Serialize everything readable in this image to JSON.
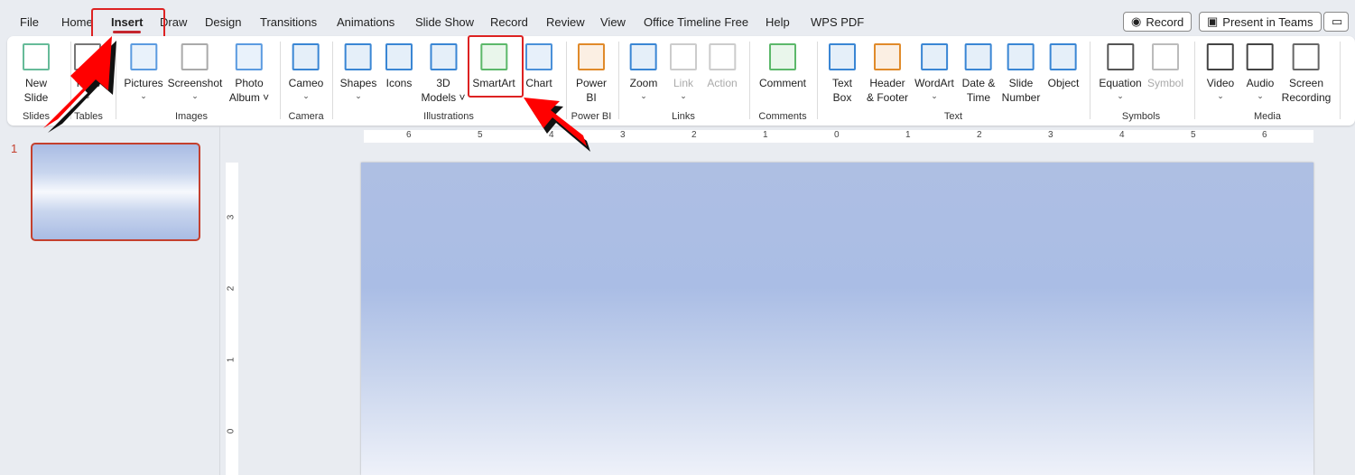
{
  "tabs": [
    "File",
    "Home",
    "Insert",
    "Draw",
    "Design",
    "Transitions",
    "Animations",
    "Slide Show",
    "Record",
    "Review",
    "View",
    "Office Timeline Free",
    "Help",
    "WPS PDF"
  ],
  "active_tab": "Insert",
  "top_buttons": {
    "record": "Record",
    "present": "Present in Teams"
  },
  "ribbon": {
    "buttons": [
      {
        "l1": "New",
        "l2": "Slide",
        "icon": "new-slide-icon",
        "chev": false,
        "dis": false
      },
      {
        "l1": "Table",
        "l2": "",
        "icon": "table-icon",
        "chev": true,
        "dis": false
      },
      {
        "l1": "Pictures",
        "l2": "",
        "icon": "pictures-icon",
        "chev": true,
        "dis": false
      },
      {
        "l1": "Screenshot",
        "l2": "",
        "icon": "screenshot-icon",
        "chev": true,
        "dis": false
      },
      {
        "l1": "Photo",
        "l2": "Album ˅",
        "icon": "photo-album-icon",
        "chev": false,
        "dis": false
      },
      {
        "l1": "Cameo",
        "l2": "",
        "icon": "cameo-icon",
        "chev": true,
        "dis": false
      },
      {
        "l1": "Shapes",
        "l2": "",
        "icon": "shapes-icon",
        "chev": true,
        "dis": false
      },
      {
        "l1": "Icons",
        "l2": "",
        "icon": "icons-icon",
        "chev": false,
        "dis": false
      },
      {
        "l1": "3D",
        "l2": "Models ˅",
        "icon": "3d-models-icon",
        "chev": false,
        "dis": false
      },
      {
        "l1": "SmartArt",
        "l2": "",
        "icon": "smartart-icon",
        "chev": false,
        "dis": false
      },
      {
        "l1": "Chart",
        "l2": "",
        "icon": "chart-icon",
        "chev": false,
        "dis": false
      },
      {
        "l1": "Power",
        "l2": "BI",
        "icon": "power-bi-icon",
        "chev": false,
        "dis": false
      },
      {
        "l1": "Zoom",
        "l2": "",
        "icon": "zoom-icon",
        "chev": true,
        "dis": false
      },
      {
        "l1": "Link",
        "l2": "",
        "icon": "link-icon",
        "chev": true,
        "dis": true
      },
      {
        "l1": "Action",
        "l2": "",
        "icon": "action-icon",
        "chev": false,
        "dis": true
      },
      {
        "l1": "Comment",
        "l2": "",
        "icon": "comment-icon",
        "chev": false,
        "dis": false
      },
      {
        "l1": "Text",
        "l2": "Box",
        "icon": "text-box-icon",
        "chev": false,
        "dis": false
      },
      {
        "l1": "Header",
        "l2": "& Footer",
        "icon": "header-footer-icon",
        "chev": false,
        "dis": false
      },
      {
        "l1": "WordArt",
        "l2": "",
        "icon": "wordart-icon",
        "chev": true,
        "dis": false
      },
      {
        "l1": "Date &",
        "l2": "Time",
        "icon": "date-time-icon",
        "chev": false,
        "dis": false
      },
      {
        "l1": "Slide",
        "l2": "Number",
        "icon": "slide-number-icon",
        "chev": false,
        "dis": false
      },
      {
        "l1": "Object",
        "l2": "",
        "icon": "object-icon",
        "chev": false,
        "dis": false
      },
      {
        "l1": "Equation",
        "l2": "",
        "icon": "equation-icon",
        "chev": true,
        "dis": false
      },
      {
        "l1": "Symbol",
        "l2": "",
        "icon": "symbol-icon",
        "chev": false,
        "dis": true
      },
      {
        "l1": "Video",
        "l2": "",
        "icon": "video-icon",
        "chev": true,
        "dis": false
      },
      {
        "l1": "Audio",
        "l2": "",
        "icon": "audio-icon",
        "chev": true,
        "dis": false
      },
      {
        "l1": "Screen",
        "l2": "Recording",
        "icon": "screen-recording-icon",
        "chev": false,
        "dis": false
      }
    ],
    "groups": [
      "Slides",
      "Tables",
      "Images",
      "Camera",
      "Illustrations",
      "Power BI",
      "Links",
      "Comments",
      "Text",
      "Symbols",
      "Media"
    ]
  },
  "slide_number": "1",
  "hruler": [
    "6",
    "5",
    "4",
    "3",
    "2",
    "1",
    "0",
    "1",
    "2",
    "3",
    "4",
    "5",
    "6"
  ],
  "vruler": [
    "3",
    "2",
    "1",
    "0"
  ],
  "colors": {
    "accent": "#c4262e",
    "arrow": "#ff0000"
  }
}
